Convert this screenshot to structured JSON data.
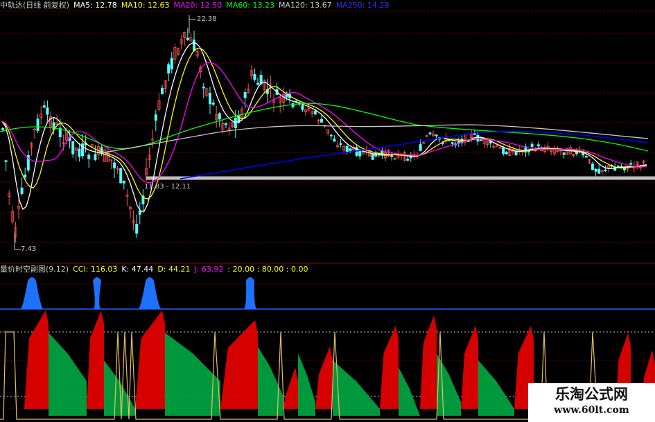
{
  "colors": {
    "background": "#000000",
    "candle_up": "#ff5050",
    "candle_down": "#54ffff",
    "ma5": "#ffffff",
    "ma10": "#ffff00",
    "ma20": "#ff00ff",
    "ma60": "#00ff00",
    "ma120": "#c8c8c8",
    "ma250": "#0000ff",
    "grid": "#7a0000",
    "support": "#c0c0c0",
    "bull_fill": "#e00000",
    "bear_fill": "#00a040",
    "blue_fill": "#1e70ff",
    "threshold_line": "#2060ff",
    "j_line": "#e8c060"
  },
  "top_legend": {
    "title": "中轨达(日线 前复权)",
    "ma5": "MA5: 12.78",
    "ma10": "MA10: 12.63",
    "ma20": "MA20: 12.50",
    "ma60": "MA60: 13.23",
    "ma120": "MA120: 13.67",
    "ma250": "MA250: 14.29"
  },
  "indicator_legend": {
    "title": "量价时空副图(9,12)",
    "cci": "CCI: 116.03",
    "k": "K: 47.44",
    "d": "D: 44.21",
    "j": "J: 63.92",
    "levels": ": 20.00 : 80.00 : 0.00"
  },
  "annotations": {
    "high": "22.38",
    "low": "7.43",
    "range": "11.83 - 12.11"
  },
  "watermark": {
    "title": "乐淘公式网",
    "url": "www.60lt.com"
  },
  "chart_data": {
    "type": "candlestick",
    "panels": [
      "price",
      "indicator"
    ],
    "price_high": 22.38,
    "price_low": 7.43,
    "indicator_levels": [
      20.0,
      80.0,
      0.0
    ]
  }
}
